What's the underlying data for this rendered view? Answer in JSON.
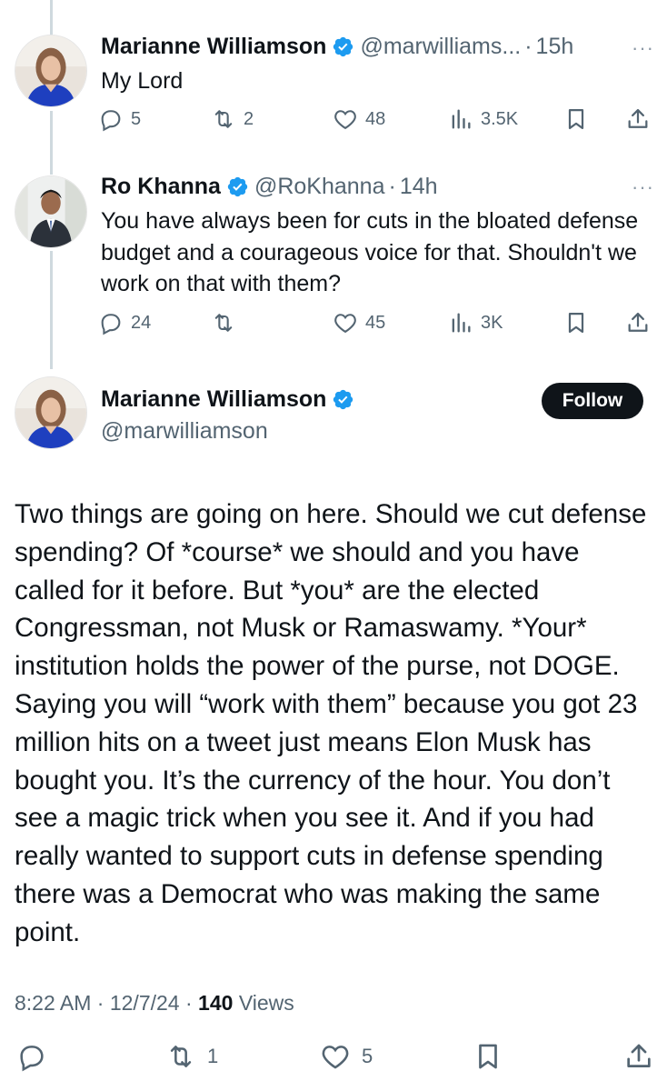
{
  "tweets": [
    {
      "name": "Marianne Williamson",
      "handle": "@marwilliams...",
      "separator": "·",
      "time": "15h",
      "more": "···",
      "text": "My Lord",
      "replies": "5",
      "reposts": "2",
      "likes": "48",
      "views": "3.5K"
    },
    {
      "name": "Ro Khanna",
      "handle": "@RoKhanna",
      "separator": "·",
      "time": "14h",
      "more": "···",
      "text": "You have always been for cuts in the bloated defense budget and a courageous voice for that. Shouldn't we work on that with them?",
      "replies": "24",
      "reposts": "",
      "likes": "45",
      "views": "3K"
    }
  ],
  "main": {
    "name": "Marianne Williamson",
    "handle": "@marwilliamson",
    "follow_label": "Follow",
    "text": "Two things are going on here. Should we cut defense spending? Of *course* we should and you have called for it before. But *you* are the elected Congressman, not Musk or Ramaswamy. *Your* institution holds the power of the purse, not DOGE. Saying you will “work with them” because you got 23 million hits on a tweet just means Elon Musk has bought you. It’s the currency of the hour. You don’t see a magic trick when you see it. And if you had really wanted to support cuts in defense spending there was a Democrat who was making the same point.",
    "time": "8:22 AM",
    "date": "12/7/24",
    "separator": "·",
    "views_count": "140",
    "views_label": "Views",
    "reposts": "1",
    "likes": "5"
  },
  "colors": {
    "text": "#0f1419",
    "secondary": "#536471",
    "verified": "#1d9bf0",
    "thread_line": "#cfd9de"
  },
  "icons": [
    "reply-icon",
    "repost-icon",
    "like-icon",
    "views-icon",
    "bookmark-icon",
    "share-icon",
    "verified-badge-icon",
    "more-icon"
  ]
}
